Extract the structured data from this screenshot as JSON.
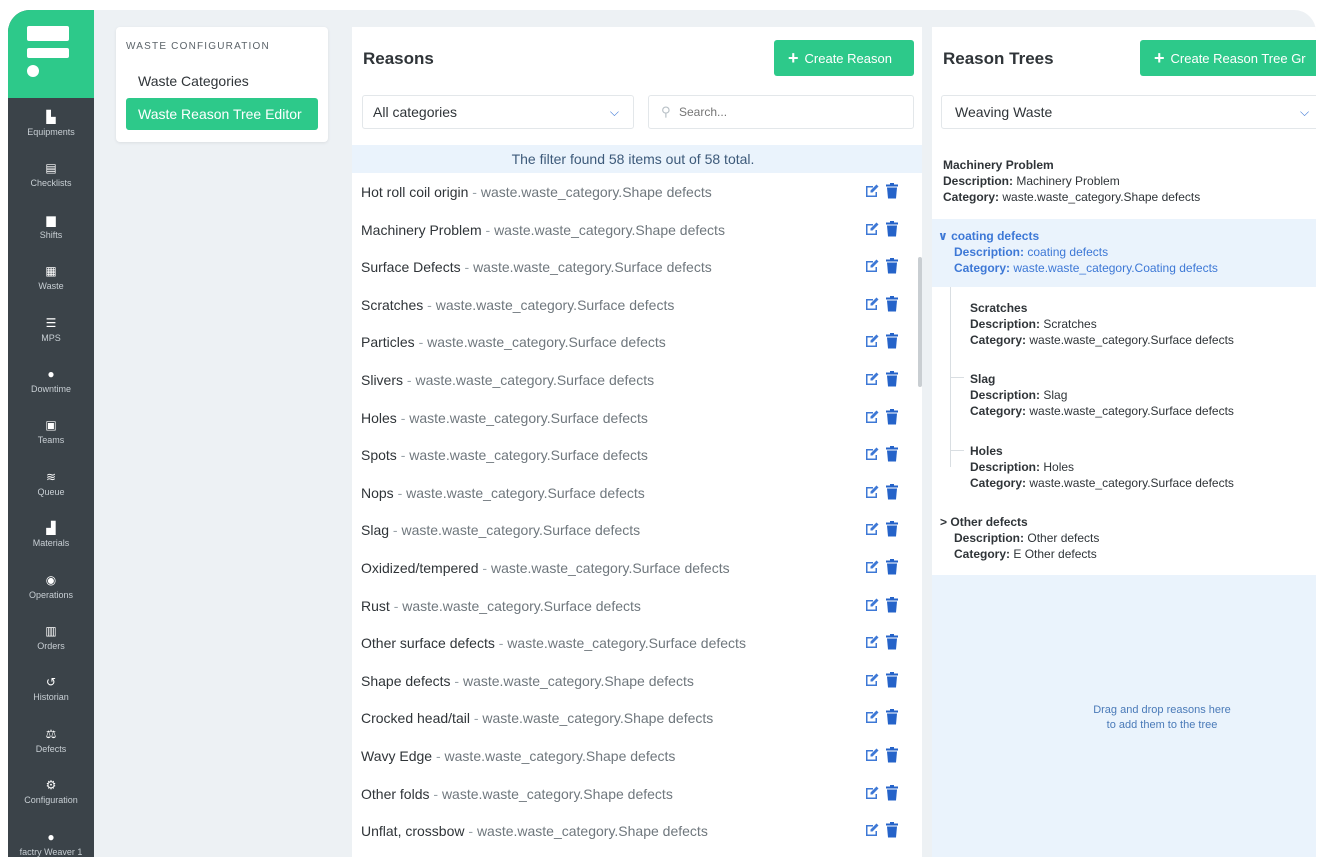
{
  "sidebar": {
    "items": [
      {
        "label": "Equipments",
        "icon": "factory-icon",
        "glyph": "▙"
      },
      {
        "label": "Checklists",
        "icon": "clipboard-icon",
        "glyph": "▤"
      },
      {
        "label": "Shifts",
        "icon": "calendar-icon",
        "glyph": "▆"
      },
      {
        "label": "Waste",
        "icon": "pallet-icon",
        "glyph": "▦"
      },
      {
        "label": "MPS",
        "icon": "list-icon",
        "glyph": "☰"
      },
      {
        "label": "Downtime",
        "icon": "clock-icon",
        "glyph": "●"
      },
      {
        "label": "Teams",
        "icon": "calendar-check-icon",
        "glyph": "▣"
      },
      {
        "label": "Queue",
        "icon": "layers-icon",
        "glyph": "≋"
      },
      {
        "label": "Materials",
        "icon": "boxes-icon",
        "glyph": "▟"
      },
      {
        "label": "Operations",
        "icon": "gauge-icon",
        "glyph": "◉"
      },
      {
        "label": "Orders",
        "icon": "orders-list-icon",
        "glyph": "▥"
      },
      {
        "label": "Historian",
        "icon": "history-icon",
        "glyph": "↺"
      },
      {
        "label": "Defects",
        "icon": "balance-icon",
        "glyph": "⚖"
      },
      {
        "label": "Configuration",
        "icon": "cogs-icon",
        "glyph": "⚙"
      },
      {
        "label": "factry Weaver 1",
        "icon": "user-icon",
        "glyph": "●"
      }
    ]
  },
  "config": {
    "title": "WASTE CONFIGURATION",
    "items": [
      {
        "label": "Waste Categories",
        "active": false
      },
      {
        "label": "Waste Reason Tree Editor",
        "active": true
      }
    ]
  },
  "reasons": {
    "title": "Reasons",
    "create_label": "Create Reason",
    "category_filter": "All categories",
    "search_placeholder": "Search...",
    "filter_info": "The filter found 58 items out of 58 total.",
    "separator": "-",
    "items": [
      {
        "name": "Hot roll coil origin",
        "category": "waste.waste_category.Shape defects"
      },
      {
        "name": "Machinery Problem",
        "category": "waste.waste_category.Shape defects"
      },
      {
        "name": "Surface Defects",
        "category": "waste.waste_category.Surface defects"
      },
      {
        "name": "Scratches",
        "category": "waste.waste_category.Surface defects"
      },
      {
        "name": "Particles",
        "category": "waste.waste_category.Surface defects"
      },
      {
        "name": "Slivers",
        "category": "waste.waste_category.Surface defects"
      },
      {
        "name": "Holes",
        "category": "waste.waste_category.Surface defects"
      },
      {
        "name": "Spots",
        "category": "waste.waste_category.Surface defects"
      },
      {
        "name": "Nops",
        "category": "waste.waste_category.Surface defects"
      },
      {
        "name": "Slag",
        "category": "waste.waste_category.Surface defects"
      },
      {
        "name": "Oxidized/tempered",
        "category": "waste.waste_category.Surface defects"
      },
      {
        "name": "Rust",
        "category": "waste.waste_category.Surface defects"
      },
      {
        "name": "Other surface defects",
        "category": "waste.waste_category.Surface defects"
      },
      {
        "name": "Shape defects",
        "category": "waste.waste_category.Shape defects"
      },
      {
        "name": "Crocked head/tail",
        "category": "waste.waste_category.Shape defects"
      },
      {
        "name": "Wavy Edge",
        "category": "waste.waste_category.Shape defects"
      },
      {
        "name": "Other folds",
        "category": "waste.waste_category.Shape defects"
      },
      {
        "name": "Unflat, crossbow",
        "category": "waste.waste_category.Shape defects"
      }
    ]
  },
  "trees": {
    "title": "Reason Trees",
    "create_label": "Create Reason Tree Gr",
    "selected_tree": "Weaving Waste",
    "desc_key": "Description:",
    "cat_key": "Category:",
    "nodes": {
      "machinery": {
        "title": "Machinery Problem",
        "description": "Machinery Problem",
        "category": "waste.waste_category.Shape defects"
      },
      "coating": {
        "arrow": "∨",
        "title": "coating defects",
        "description": "coating defects",
        "category": "waste.waste_category.Coating defects"
      },
      "scratches": {
        "title": "Scratches",
        "description": "Scratches",
        "category": "waste.waste_category.Surface defects"
      },
      "slag": {
        "title": "Slag",
        "description": "Slag",
        "category": "waste.waste_category.Surface defects"
      },
      "holes": {
        "title": "Holes",
        "description": "Holes",
        "category": "waste.waste_category.Surface defects"
      },
      "other": {
        "arrow": ">",
        "title": "Other defects",
        "description": "Other defects",
        "category": "E Other defects"
      }
    },
    "drop_line1": "Drag and drop reasons here",
    "drop_line2": "to add them to the tree"
  },
  "colors": {
    "accent": "#2dc98a",
    "sidebar_bg": "#3b4349",
    "link_blue": "#3d78d6",
    "highlight_bg": "#eaf3fc"
  }
}
